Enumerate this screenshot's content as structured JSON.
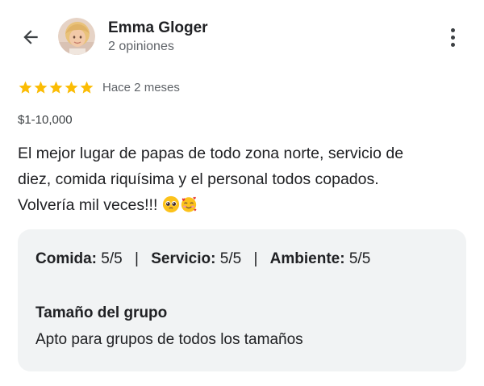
{
  "header": {
    "back_icon": "arrow-left-icon",
    "author_name": "Emma Gloger",
    "author_sub": "2 opiniones",
    "more_icon": "more-vertical-icon"
  },
  "review": {
    "rating": 5,
    "rating_max": 5,
    "star_color": "#fbbc04",
    "time": "Hace 2 meses",
    "price": "$1-10,000",
    "text_line1": "El mejor lugar de papas de todo zona norte, servicio de",
    "text_line2": "diez, comida riquísima y el personal todos copados.",
    "text_line3": "Volvería mil veces!!!",
    "emojis": [
      "pleading-face-icon",
      "smiling-face-with-hearts-icon"
    ]
  },
  "details": {
    "food_label": "Comida:",
    "food_value": "5/5",
    "service_label": "Servicio:",
    "service_value": "5/5",
    "ambience_label": "Ambiente:",
    "ambience_value": "5/5",
    "separator": "|",
    "group_title": "Tamaño del grupo",
    "group_value": "Apto para grupos de todos los tamaños"
  }
}
